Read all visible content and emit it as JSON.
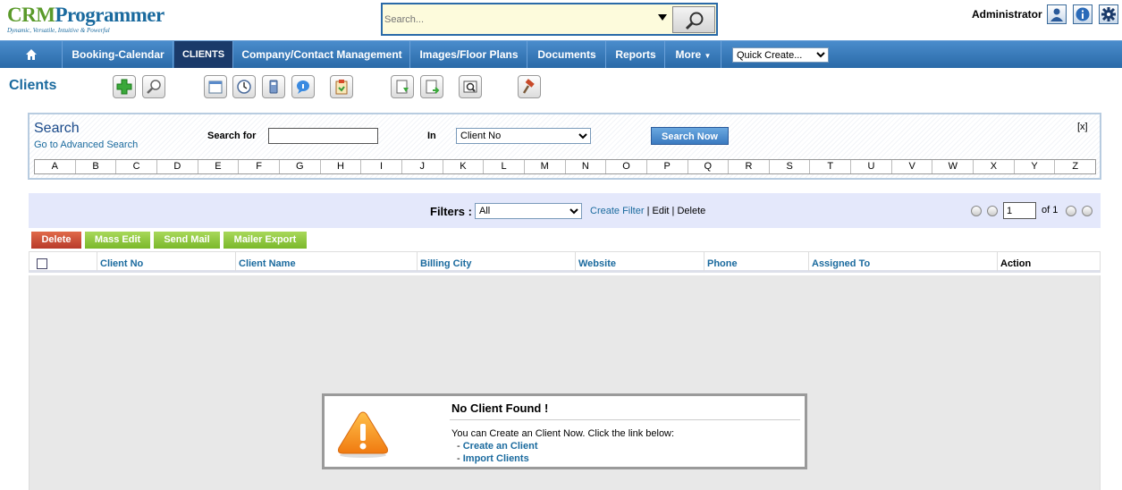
{
  "logo": {
    "brand_a": "CRM",
    "brand_b": "Programmer",
    "tagline": "Dynamic, Versatile, Intuitive & Powerful"
  },
  "topsearch": {
    "placeholder": "Search..."
  },
  "user": {
    "name": "Administrator"
  },
  "nav": {
    "items": [
      "Booking-Calendar",
      "CLIENTS",
      "Company/Contact Management",
      "Images/Floor Plans",
      "Documents",
      "Reports",
      "More"
    ],
    "active": "CLIENTS",
    "quick_create": "Quick Create..."
  },
  "module": {
    "title": "Clients"
  },
  "search": {
    "title": "Search",
    "advanced_link": "Go to Advanced Search",
    "for_label": "Search for",
    "in_label": "In",
    "in_value": "Client No",
    "button": "Search Now",
    "close": "[x]",
    "alphabet": [
      "A",
      "B",
      "C",
      "D",
      "E",
      "F",
      "G",
      "H",
      "I",
      "J",
      "K",
      "L",
      "M",
      "N",
      "O",
      "P",
      "Q",
      "R",
      "S",
      "T",
      "U",
      "V",
      "W",
      "X",
      "Y",
      "Z"
    ]
  },
  "filters": {
    "label": "Filters :",
    "value": "All",
    "create_filter": "Create Filter",
    "sep1": " | ",
    "edit": "Edit",
    "sep2": " | ",
    "delete": "Delete"
  },
  "pagination": {
    "page": "1",
    "of": "of 1"
  },
  "actions": {
    "delete": "Delete",
    "mass_edit": "Mass Edit",
    "send_mail": "Send Mail",
    "mailer_export": "Mailer Export"
  },
  "table": {
    "columns": [
      "Client No",
      "Client Name",
      "Billing City",
      "Website",
      "Phone",
      "Assigned To",
      "Action"
    ]
  },
  "empty": {
    "title": "No Client Found !",
    "message": "You can Create an Client Now. Click the link below:",
    "dash": "- ",
    "link_create": "Create an Client",
    "link_import": "Import Clients"
  },
  "colors": {
    "nav": "#2a6aa8",
    "brand": "#1a6a9e",
    "filterbar": "#e4e8fb"
  }
}
